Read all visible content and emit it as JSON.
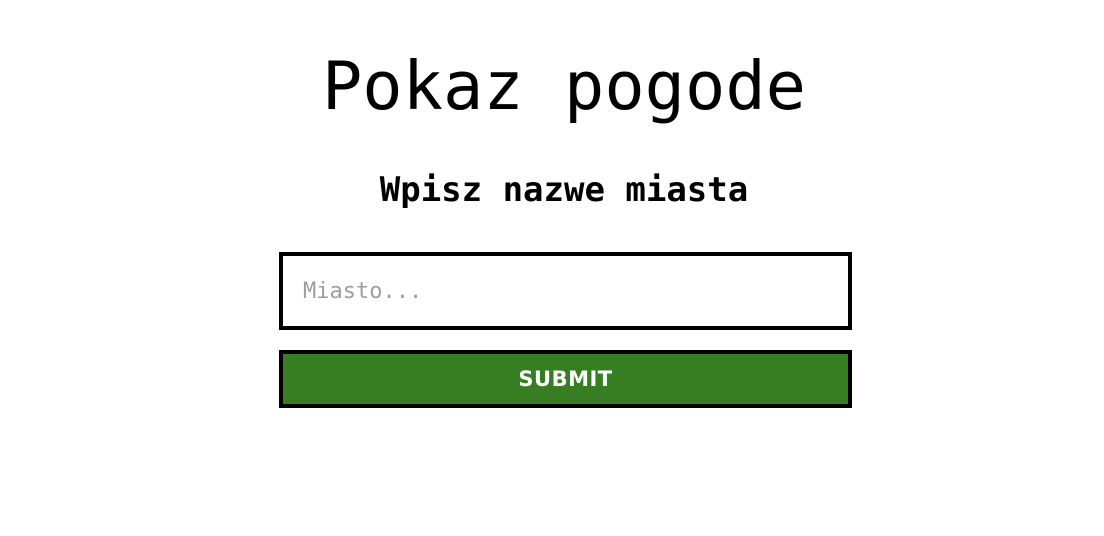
{
  "header": {
    "title": "Pokaz pogode",
    "subtitle": "Wpisz nazwe miasta"
  },
  "form": {
    "city_input": {
      "value": "",
      "placeholder": "Miasto..."
    },
    "submit_label": "SUBMIT",
    "submit_color": "#377e22"
  }
}
